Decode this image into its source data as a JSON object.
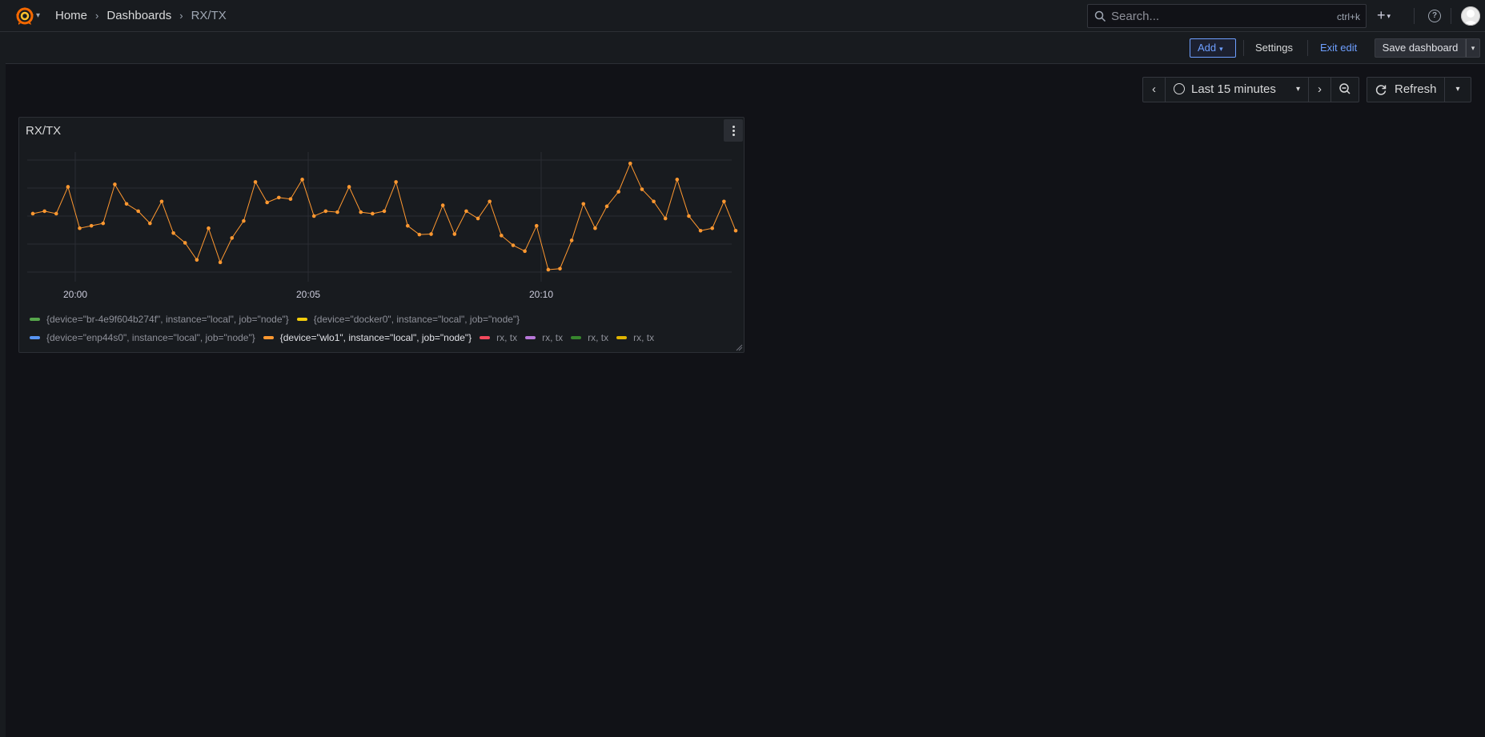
{
  "topbar": {
    "breadcrumb": [
      "Home",
      "Dashboards",
      "RX/TX"
    ],
    "search_placeholder": "Search...",
    "search_shortcut": "ctrl+k"
  },
  "editbar": {
    "add_label": "Add",
    "settings_label": "Settings",
    "exit_label": "Exit edit",
    "save_label": "Save dashboard"
  },
  "time": {
    "range_label": "Last 15 minutes",
    "refresh_label": "Refresh"
  },
  "panel": {
    "title": "RX/TX"
  },
  "chart_data": {
    "type": "line",
    "x_ticks": [
      "20:00",
      "20:05",
      "20:10"
    ],
    "grid": true,
    "series": [
      {
        "name": "{device=\"wlo1\", instance=\"local\", job=\"node\"}",
        "color": "#ff9830",
        "values": [
          0.05,
          0.1,
          0.05,
          0.6,
          -0.25,
          -0.2,
          -0.15,
          0.65,
          0.25,
          0.1,
          -0.15,
          0.3,
          -0.35,
          -0.55,
          -0.9,
          -0.25,
          -0.95,
          -0.45,
          -0.1,
          0.7,
          0.28,
          0.38,
          0.35,
          0.75,
          0.0,
          0.1,
          0.08,
          0.6,
          0.08,
          0.05,
          0.1,
          0.7,
          -0.2,
          -0.38,
          -0.37,
          0.22,
          -0.37,
          0.1,
          -0.05,
          0.3,
          -0.4,
          -0.6,
          -0.72,
          -0.2,
          -1.1,
          -1.08,
          -0.5,
          0.25,
          -0.25,
          0.2,
          0.5,
          1.08,
          0.55,
          0.3,
          -0.05,
          0.75,
          0.0,
          -0.3,
          -0.25,
          0.3,
          -0.3
        ]
      }
    ],
    "legend": [
      {
        "label": "{device=\"br-4e9f604b274f\", instance=\"local\", job=\"node\"}",
        "color": "#56a64b",
        "active": false
      },
      {
        "label": "{device=\"docker0\", instance=\"local\", job=\"node\"}",
        "color": "#f2cc0c",
        "active": false
      },
      {
        "label": "{device=\"enp44s0\", instance=\"local\", job=\"node\"}",
        "color": "#5794f2",
        "active": false
      },
      {
        "label": "{device=\"wlo1\", instance=\"local\", job=\"node\"}",
        "color": "#ff9830",
        "active": true
      },
      {
        "label": "rx, tx",
        "color": "#f2495c",
        "active": false
      },
      {
        "label": "rx, tx",
        "color": "#b877d9",
        "active": false
      },
      {
        "label": "rx, tx",
        "color": "#37872d",
        "active": false
      },
      {
        "label": "rx, tx",
        "color": "#e0b400",
        "active": false
      }
    ]
  }
}
